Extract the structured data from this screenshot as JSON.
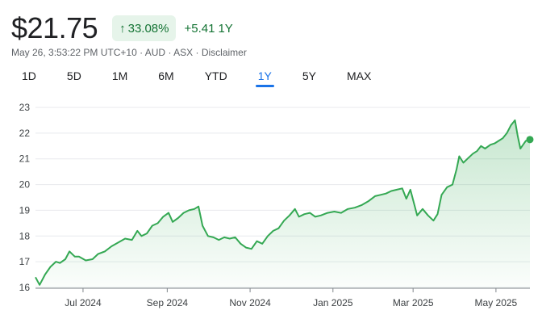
{
  "quote": {
    "price": "$21.75",
    "change_percent": "33.08%",
    "change_abs": "+5.41",
    "period": "1Y",
    "timestamp": "May 26, 3:53:22 PM UTC+10",
    "currency": "AUD",
    "exchange": "ASX",
    "disclaimer": "Disclaimer",
    "positive_color": "#137333",
    "badge_bg": "#e6f4ea",
    "arrow_icon": "arrow-up-icon"
  },
  "tabs": [
    {
      "label": "1D"
    },
    {
      "label": "5D"
    },
    {
      "label": "1M"
    },
    {
      "label": "6M"
    },
    {
      "label": "YTD"
    },
    {
      "label": "1Y",
      "active": true
    },
    {
      "label": "5Y"
    },
    {
      "label": "MAX"
    }
  ],
  "chart_data": {
    "type": "area",
    "title": "",
    "xlabel": "",
    "ylabel": "",
    "ylim": [
      16,
      23
    ],
    "yticks": [
      16,
      17,
      18,
      19,
      20,
      21,
      22,
      23
    ],
    "xticks": [
      {
        "label": "Jul 2024",
        "x": "2024-07-01"
      },
      {
        "label": "Sep 2024",
        "x": "2024-09-01"
      },
      {
        "label": "Nov 2024",
        "x": "2024-11-01"
      },
      {
        "label": "Jan 2025",
        "x": "2025-01-01"
      },
      {
        "label": "Mar 2025",
        "x": "2025-03-01"
      },
      {
        "label": "May 2025",
        "x": "2025-05-01"
      }
    ],
    "xlim": [
      "2024-05-27",
      "2025-05-26"
    ],
    "grid": true,
    "line_color": "#34a853",
    "series": [
      {
        "points": [
          [
            "2024-05-27",
            16.4
          ],
          [
            "2024-05-30",
            16.1
          ],
          [
            "2024-06-03",
            16.5
          ],
          [
            "2024-06-07",
            16.8
          ],
          [
            "2024-06-11",
            17.0
          ],
          [
            "2024-06-14",
            16.95
          ],
          [
            "2024-06-18",
            17.1
          ],
          [
            "2024-06-21",
            17.4
          ],
          [
            "2024-06-25",
            17.2
          ],
          [
            "2024-06-28",
            17.2
          ],
          [
            "2024-07-03",
            17.05
          ],
          [
            "2024-07-08",
            17.1
          ],
          [
            "2024-07-12",
            17.3
          ],
          [
            "2024-07-17",
            17.4
          ],
          [
            "2024-07-22",
            17.6
          ],
          [
            "2024-07-27",
            17.75
          ],
          [
            "2024-08-01",
            17.9
          ],
          [
            "2024-08-06",
            17.85
          ],
          [
            "2024-08-10",
            18.2
          ],
          [
            "2024-08-13",
            18.0
          ],
          [
            "2024-08-17",
            18.1
          ],
          [
            "2024-08-21",
            18.4
          ],
          [
            "2024-08-25",
            18.5
          ],
          [
            "2024-08-29",
            18.75
          ],
          [
            "2024-09-02",
            18.9
          ],
          [
            "2024-09-05",
            18.55
          ],
          [
            "2024-09-09",
            18.7
          ],
          [
            "2024-09-13",
            18.9
          ],
          [
            "2024-09-17",
            19.0
          ],
          [
            "2024-09-21",
            19.05
          ],
          [
            "2024-09-24",
            19.15
          ],
          [
            "2024-09-27",
            18.4
          ],
          [
            "2024-10-01",
            18.0
          ],
          [
            "2024-10-05",
            17.95
          ],
          [
            "2024-10-09",
            17.85
          ],
          [
            "2024-10-13",
            17.95
          ],
          [
            "2024-10-17",
            17.9
          ],
          [
            "2024-10-21",
            17.95
          ],
          [
            "2024-10-25",
            17.7
          ],
          [
            "2024-10-29",
            17.55
          ],
          [
            "2024-11-02",
            17.5
          ],
          [
            "2024-11-06",
            17.8
          ],
          [
            "2024-11-10",
            17.7
          ],
          [
            "2024-11-14",
            18.0
          ],
          [
            "2024-11-18",
            18.2
          ],
          [
            "2024-11-22",
            18.3
          ],
          [
            "2024-11-26",
            18.6
          ],
          [
            "2024-11-30",
            18.8
          ],
          [
            "2024-12-04",
            19.05
          ],
          [
            "2024-12-07",
            18.75
          ],
          [
            "2024-12-11",
            18.85
          ],
          [
            "2024-12-15",
            18.9
          ],
          [
            "2024-12-19",
            18.75
          ],
          [
            "2024-12-23",
            18.8
          ],
          [
            "2024-12-28",
            18.9
          ],
          [
            "2025-01-02",
            18.95
          ],
          [
            "2025-01-07",
            18.9
          ],
          [
            "2025-01-12",
            19.05
          ],
          [
            "2025-01-17",
            19.1
          ],
          [
            "2025-01-22",
            19.2
          ],
          [
            "2025-01-27",
            19.35
          ],
          [
            "2025-02-01",
            19.55
          ],
          [
            "2025-02-05",
            19.6
          ],
          [
            "2025-02-09",
            19.65
          ],
          [
            "2025-02-13",
            19.75
          ],
          [
            "2025-02-17",
            19.8
          ],
          [
            "2025-02-21",
            19.85
          ],
          [
            "2025-02-24",
            19.45
          ],
          [
            "2025-02-27",
            19.8
          ],
          [
            "2025-03-02",
            19.2
          ],
          [
            "2025-03-04",
            18.8
          ],
          [
            "2025-03-08",
            19.05
          ],
          [
            "2025-03-12",
            18.8
          ],
          [
            "2025-03-16",
            18.6
          ],
          [
            "2025-03-19",
            18.85
          ],
          [
            "2025-03-22",
            19.6
          ],
          [
            "2025-03-26",
            19.9
          ],
          [
            "2025-03-30",
            20.0
          ],
          [
            "2025-04-02",
            20.6
          ],
          [
            "2025-04-04",
            21.1
          ],
          [
            "2025-04-07",
            20.85
          ],
          [
            "2025-04-10",
            21.0
          ],
          [
            "2025-04-14",
            21.2
          ],
          [
            "2025-04-17",
            21.3
          ],
          [
            "2025-04-20",
            21.5
          ],
          [
            "2025-04-23",
            21.4
          ],
          [
            "2025-04-27",
            21.55
          ],
          [
            "2025-04-30",
            21.6
          ],
          [
            "2025-05-03",
            21.7
          ],
          [
            "2025-05-06",
            21.8
          ],
          [
            "2025-05-09",
            22.0
          ],
          [
            "2025-05-12",
            22.3
          ],
          [
            "2025-05-15",
            22.5
          ],
          [
            "2025-05-17",
            21.9
          ],
          [
            "2025-05-19",
            21.4
          ],
          [
            "2025-05-21",
            21.55
          ],
          [
            "2025-05-23",
            21.7
          ],
          [
            "2025-05-26",
            21.75
          ]
        ]
      }
    ]
  }
}
